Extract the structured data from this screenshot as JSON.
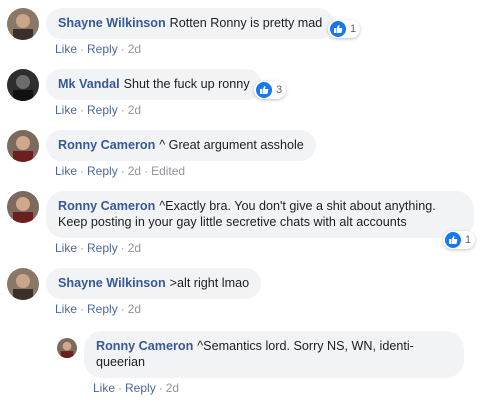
{
  "comments": [
    {
      "author": "Shayne Wilkinson",
      "text": "Rotten Ronny is pretty mad",
      "reactions": "1",
      "actions": {
        "like": "Like",
        "reply": "Reply",
        "time": "2d"
      }
    },
    {
      "author": "Mk Vandal",
      "text": "Shut the fuck up ronny",
      "reactions": "3",
      "actions": {
        "like": "Like",
        "reply": "Reply",
        "time": "2d"
      }
    },
    {
      "author": "Ronny Cameron",
      "text": "^ Great argument asshole",
      "actions": {
        "like": "Like",
        "reply": "Reply",
        "time": "2d",
        "edited": "Edited"
      }
    },
    {
      "author": "Ronny Cameron",
      "text": "^Exactly bra. You don't give a shit about anything. Keep posting in your gay little secretive chats with alt accounts",
      "reactions": "1",
      "actions": {
        "like": "Like",
        "reply": "Reply",
        "time": "2d"
      }
    },
    {
      "author": "Shayne Wilkinson",
      "text": ">alt right lmao",
      "actions": {
        "like": "Like",
        "reply": "Reply",
        "time": "2d"
      }
    },
    {
      "author": "Ronny Cameron",
      "text": "^Semantics lord. Sorry NS, WN, identi-queerian",
      "actions": {
        "like": "Like",
        "reply": "Reply",
        "time": "2d"
      }
    }
  ],
  "colors": {
    "author_name": "#385898",
    "bubble_bg": "#f2f3f5",
    "like_blue": "#1877f2",
    "action_link": "#4b67a1",
    "meta_gray": "#90949c"
  },
  "icons": {
    "reaction": "like-thumb-icon",
    "avatar": "profile-avatar"
  }
}
